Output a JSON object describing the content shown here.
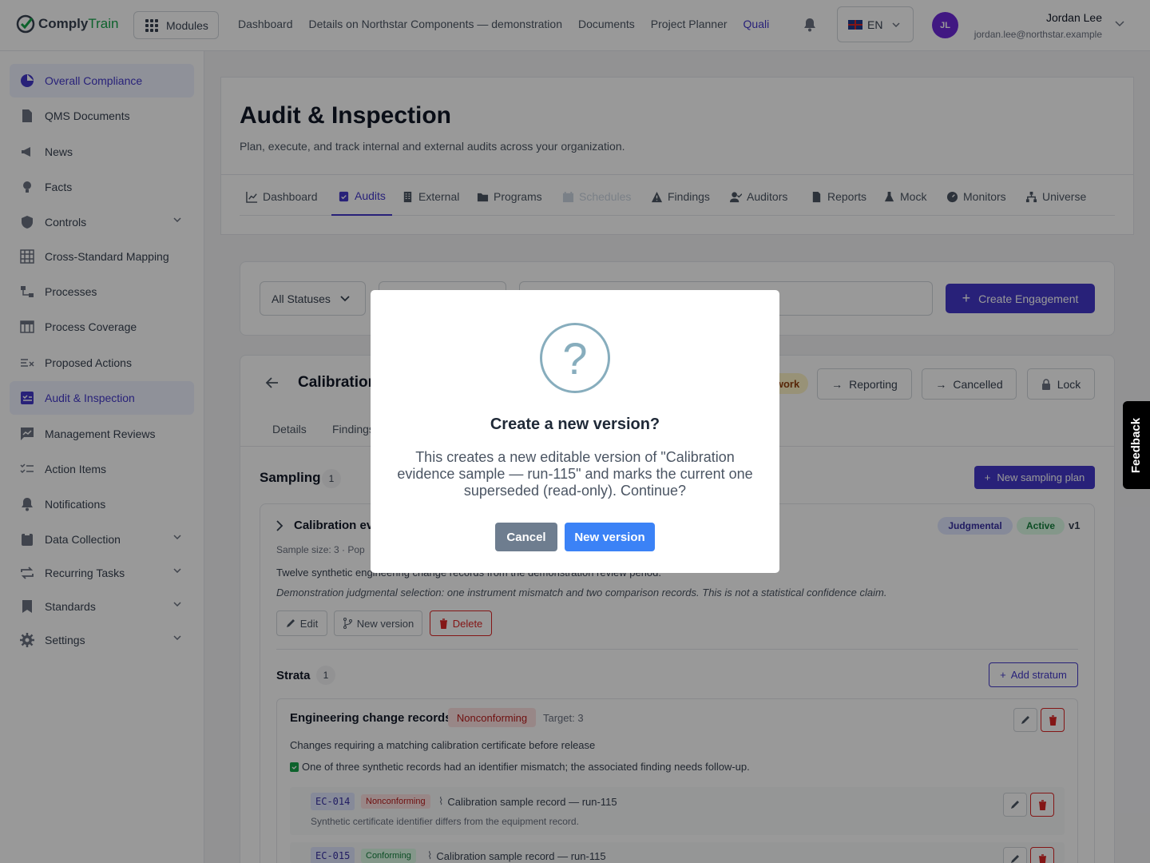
{
  "brand": {
    "part1": "Comply",
    "part2": "Train"
  },
  "topbar": {
    "modules_label": "Modules",
    "nav": [
      "Dashboard",
      "Details on Northstar Components — demonstration",
      "Documents",
      "Project Planner",
      "Quali"
    ],
    "language": "EN",
    "user_initials": "JL",
    "user_name": "Jordan Lee",
    "user_email": "jordan.lee@northstar.example"
  },
  "sidebar": {
    "items": [
      {
        "label": "Overall Compliance",
        "active": true
      },
      {
        "label": "QMS Documents"
      },
      {
        "label": "News"
      },
      {
        "label": "Facts"
      },
      {
        "label": "Controls",
        "expandable": true
      },
      {
        "label": "Cross-Standard Mapping"
      },
      {
        "label": "Processes"
      },
      {
        "label": "Process Coverage"
      },
      {
        "label": "Proposed Actions"
      },
      {
        "label": "Audit & Inspection",
        "active": true
      },
      {
        "label": "Management Reviews"
      },
      {
        "label": "Action Items"
      },
      {
        "label": "Notifications"
      },
      {
        "label": "Data Collection",
        "expandable": true
      },
      {
        "label": "Recurring Tasks",
        "expandable": true
      },
      {
        "label": "Standards",
        "expandable": true
      },
      {
        "label": "Settings",
        "expandable": true
      }
    ]
  },
  "page": {
    "title": "Audit & Inspection",
    "subtitle": "Plan, execute, and track internal and external audits across your organization.",
    "tabs": [
      "Dashboard",
      "Audits",
      "External",
      "Programs",
      "Schedules",
      "Findings",
      "Auditors",
      "Reports",
      "Mock",
      "Monitors",
      "Universe"
    ]
  },
  "filters": {
    "status": "All Statuses",
    "create_label": "Create Engagement"
  },
  "engagement": {
    "title": "Calibration",
    "badge": "work",
    "actions": [
      "Reporting",
      "Cancelled",
      "Lock"
    ],
    "subtabs": [
      "Details",
      "Findings"
    ]
  },
  "sampling": {
    "title": "Sampling",
    "count": "1",
    "new_plan_label": "New sampling plan",
    "plan": {
      "title": "Calibration ev",
      "method": "Judgmental",
      "status": "Active",
      "version": "v1",
      "meta_size": "Sample size: 3",
      "meta_pop": "Pop",
      "description": "Twelve synthetic engineering change records from the demonstration review period.",
      "rationale": "Demonstration judgmental selection: one instrument mismatch and two comparison records. This is not a statistical confidence claim.",
      "buttons": {
        "edit": "Edit",
        "new_version": "New version",
        "delete": "Delete"
      }
    },
    "strata": {
      "title": "Strata",
      "count": "1",
      "add_label": "Add stratum",
      "item": {
        "name": "Engineering change records",
        "status": "Nonconforming",
        "target": "Target: 3",
        "description": "Changes requiring a matching calibration certificate before release",
        "note": "One of three synthetic records had an identifier mismatch; the associated finding needs follow-up.",
        "records": [
          {
            "code": "EC-014",
            "status": "Nonconforming",
            "title": "Calibration sample record — run-115",
            "desc": "Synthetic certificate identifier differs from the equipment record."
          },
          {
            "code": "EC-015",
            "status": "Conforming",
            "title": "Calibration sample record — run-115",
            "desc": ""
          }
        ]
      }
    }
  },
  "feedback_label": "Feedback",
  "modal": {
    "icon": "?",
    "title": "Create a new version?",
    "body": "This creates a new editable version of \"Calibration evidence sample — run-115\" and marks the current one superseded (read-only). Continue?",
    "cancel_label": "Cancel",
    "confirm_label": "New version"
  },
  "colors": {
    "accent": "#4338ca",
    "brand_green": "#16a34a",
    "danger": "#dc2626",
    "modal_confirm": "#3b82f6",
    "modal_cancel": "#6e7d8f"
  }
}
